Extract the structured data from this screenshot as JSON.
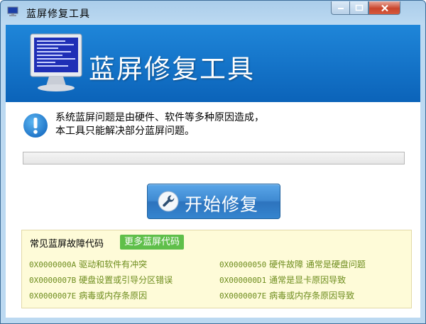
{
  "window": {
    "title": "蓝屏修复工具",
    "controls": {
      "minimize": "minimize-icon",
      "maximize": "maximize-icon",
      "close": "close-icon"
    },
    "close_color": "#c9452c"
  },
  "banner": {
    "title": "蓝屏修复工具",
    "logo_icon": "bsod-monitor-icon",
    "color": "#1a7bd0"
  },
  "message": {
    "icon": "info-icon",
    "line1": "系统蓝屏问题是由硬件、软件等多种原因造成，",
    "line2": "本工具只能解决部分蓝屏问题。"
  },
  "progress": {
    "value": 0
  },
  "start_button": {
    "label": "开始修复",
    "icon": "wrench-icon"
  },
  "codes": {
    "title": "常见蓝屏故障代码",
    "more_label": "更多蓝屏代码",
    "items": [
      {
        "code": "0X0000000A",
        "desc": "驱动和软件有冲突"
      },
      {
        "code": "0X00000050",
        "desc": "硬件故障 通常是硬盘问题"
      },
      {
        "code": "0X0000007B",
        "desc": "硬盘设置或引导分区错误"
      },
      {
        "code": "0X000000D1",
        "desc": "通常是显卡原因导致"
      },
      {
        "code": "0X0000007E",
        "desc": "病毒或内存条原因"
      },
      {
        "code": "0X0000007E",
        "desc": "病毒或内存条原因导致"
      }
    ],
    "text_color": "#6e8d1e",
    "more_color": "#5fbf4a"
  }
}
